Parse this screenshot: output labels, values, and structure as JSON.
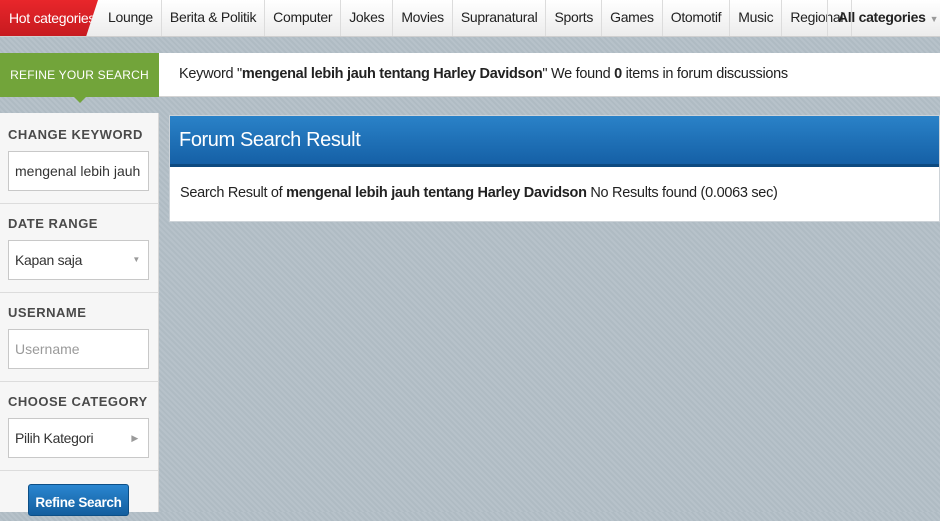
{
  "nav": {
    "hot": "Hot categories",
    "items": [
      "Lounge",
      "Berita & Politik",
      "Computer",
      "Jokes",
      "Movies",
      "Supranatural",
      "Sports",
      "Games",
      "Otomotif",
      "Music",
      "Regional"
    ],
    "all_categories": "All categories"
  },
  "refine": {
    "tab_label": "REFINE YOUR SEARCH",
    "keyword_prefix": "Keyword \"",
    "keyword": "mengenal lebih jauh tentang Harley Davidson",
    "keyword_suffix": "\" We found ",
    "count": "0",
    "count_suffix": " items in forum discussions"
  },
  "sidebar": {
    "change_keyword_title": "CHANGE KEYWORD",
    "keyword_value": "mengenal lebih jauh tentang Harley Davidson",
    "date_range_title": "DATE RANGE",
    "date_range_value": "Kapan saja",
    "username_title": "USERNAME",
    "username_placeholder": "Username",
    "category_title": "CHOOSE CATEGORY",
    "category_value": "Pilih Kategori",
    "button_label": "Refine Search"
  },
  "results": {
    "title": "Forum Search Result",
    "prefix": "Search Result of ",
    "keyword": "mengenal lebih jauh tentang Harley Davidson",
    "suffix": " No Results found (0.0063 sec)"
  },
  "icons": {
    "dropdown": "chevron-down-icon",
    "arrow": "chevron-right-icon"
  },
  "colors": {
    "hot": "#d42026",
    "refine_green": "#72a43a",
    "header_blue": "#1c6db5"
  }
}
